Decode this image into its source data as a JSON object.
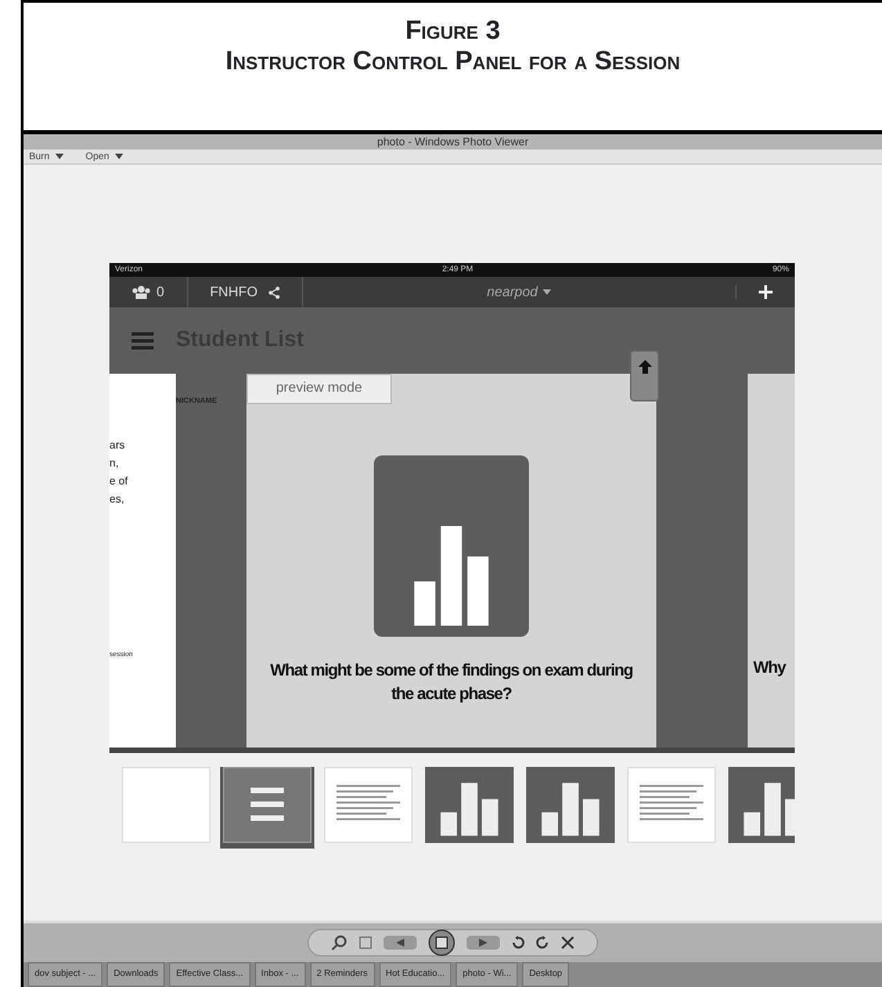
{
  "figure": {
    "label": "Figure 3",
    "title": "Instructor Control Panel for a Session"
  },
  "viewer": {
    "title": "photo - Windows Photo Viewer",
    "menu": [
      {
        "label": "Burn"
      },
      {
        "label": "Open"
      }
    ]
  },
  "device": {
    "status": {
      "carrier": "Verizon",
      "time": "2:49 PM",
      "battery": "90%"
    },
    "nav": {
      "count": "0",
      "class_code": "FNHFO",
      "app_name": "nearpod"
    },
    "header": {
      "title": "Student List"
    },
    "left_panel": {
      "lines": [
        "ars",
        "n,",
        "e of",
        "es,"
      ],
      "footer": "session"
    },
    "column_heading": "NICKNAME",
    "slide": {
      "mode_tab": "preview mode",
      "question": "What might be some of the findings on exam during the acute phase?"
    },
    "next_slide": {
      "question": "Why"
    },
    "thumbnails": [
      {
        "kind": "blank",
        "selected": false
      },
      {
        "kind": "list",
        "selected": true
      },
      {
        "kind": "text",
        "selected": false
      },
      {
        "kind": "chart",
        "selected": false
      },
      {
        "kind": "chart",
        "selected": false
      },
      {
        "kind": "text",
        "selected": false
      },
      {
        "kind": "chart",
        "selected": false
      }
    ]
  },
  "taskbar": [
    {
      "label": "dov subject - ..."
    },
    {
      "label": "Downloads"
    },
    {
      "label": "Effective Class..."
    },
    {
      "label": "Inbox - ..."
    },
    {
      "label": "2 Reminders"
    },
    {
      "label": "Hot Educatio..."
    },
    {
      "label": "photo - Wi..."
    },
    {
      "label": "Desktop"
    }
  ]
}
